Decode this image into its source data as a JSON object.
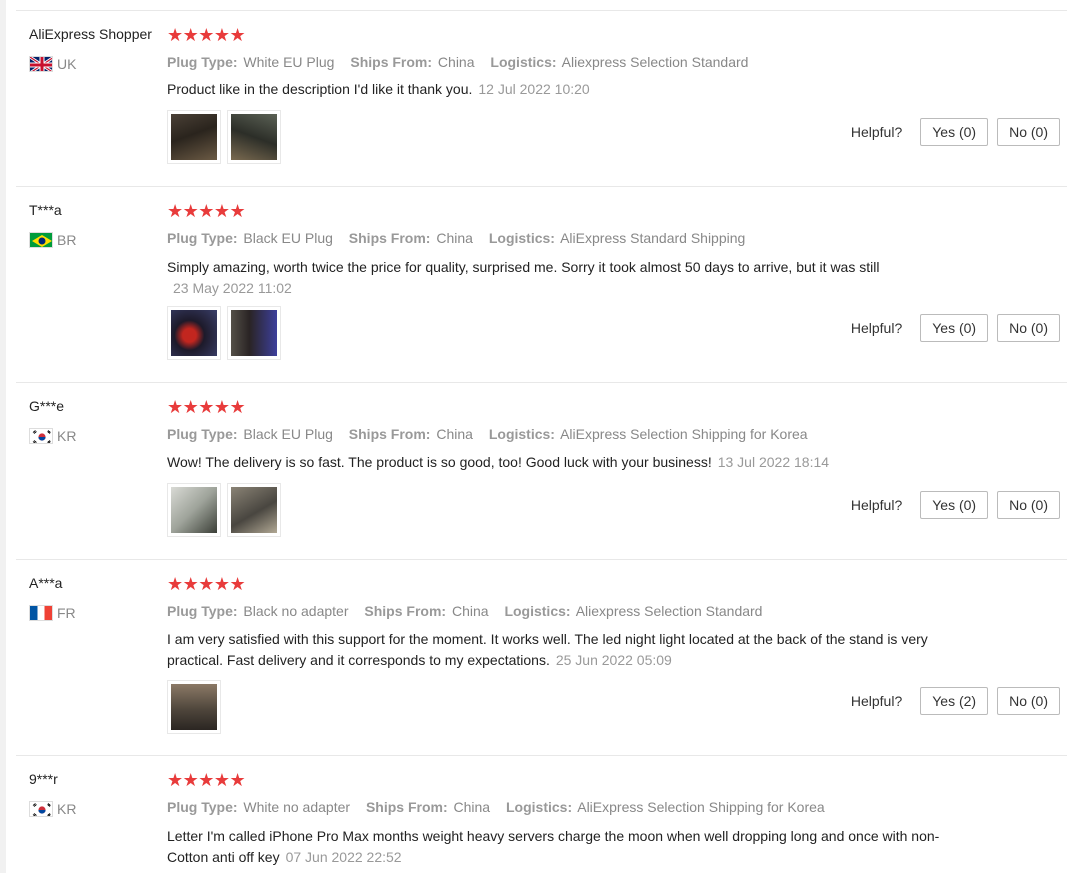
{
  "reviews": [
    {
      "user": "AliExpress Shopper",
      "country": "UK",
      "stars": "★★★★★",
      "plug_label": "Plug Type:",
      "plug": "White EU Plug",
      "ships_label": "Ships From:",
      "ships": "China",
      "logistics_label": "Logistics:",
      "logistics": "Aliexpress Selection Standard",
      "text": "Product like in the description I'd like it thank you.",
      "date": "12 Jul 2022 10:20",
      "helpful": "Helpful?",
      "yes": "Yes (0)",
      "no": "No (0)"
    },
    {
      "user": "T***a",
      "country": "BR",
      "stars": "★★★★★",
      "plug_label": "Plug Type:",
      "plug": "Black EU Plug",
      "ships_label": "Ships From:",
      "ships": "China",
      "logistics_label": "Logistics:",
      "logistics": "AliExpress Standard Shipping",
      "text": "Simply amazing, worth twice the price for quality, surprised me. Sorry it took almost 50 days to arrive, but it was still",
      "date": "23 May 2022 11:02",
      "helpful": "Helpful?",
      "yes": "Yes (0)",
      "no": "No (0)"
    },
    {
      "user": "G***e",
      "country": "KR",
      "stars": "★★★★★",
      "plug_label": "Plug Type:",
      "plug": "Black EU Plug",
      "ships_label": "Ships From:",
      "ships": "China",
      "logistics_label": "Logistics:",
      "logistics": "AliExpress Selection Shipping for Korea",
      "text": "Wow! The delivery is so fast. The product is so good, too! Good luck with your business!",
      "date": "13 Jul 2022 18:14",
      "helpful": "Helpful?",
      "yes": "Yes (0)",
      "no": "No (0)"
    },
    {
      "user": "A***a",
      "country": "FR",
      "stars": "★★★★★",
      "plug_label": "Plug Type:",
      "plug": "Black no adapter",
      "ships_label": "Ships From:",
      "ships": "China",
      "logistics_label": "Logistics:",
      "logistics": "Aliexpress Selection Standard",
      "text": "I am very satisfied with this support for the moment. It works well. The led night light located at the back of the stand is very practical. Fast delivery and it corresponds to my expectations.",
      "date": "25 Jun 2022 05:09",
      "helpful": "Helpful?",
      "yes": "Yes (2)",
      "no": "No (0)"
    },
    {
      "user": "9***r",
      "country": "KR",
      "stars": "★★★★★",
      "plug_label": "Plug Type:",
      "plug": "White no adapter",
      "ships_label": "Ships From:",
      "ships": "China",
      "logistics_label": "Logistics:",
      "logistics": "AliExpress Selection Shipping for Korea",
      "text": "Letter I'm called iPhone Pro Max months weight heavy servers charge the moon when well dropping long and once with non-Cotton anti off key",
      "date": "07 Jun 2022 22:52"
    }
  ]
}
